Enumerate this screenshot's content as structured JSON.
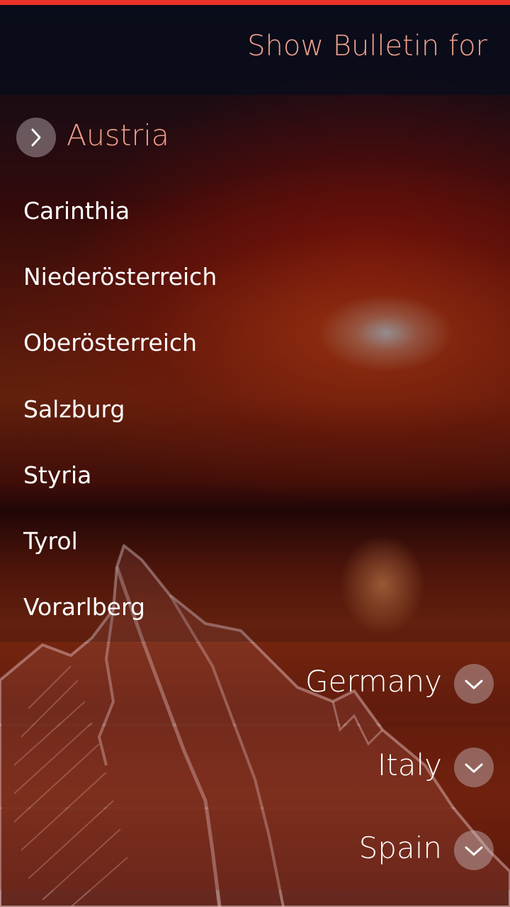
{
  "header": {
    "title": "Show Bulletin for"
  },
  "accent_color": "#e8322a",
  "highlight_color": "#f0a08c",
  "expanded_country": {
    "name": "Austria",
    "icon": "chevron-right-icon",
    "regions": [
      "Carinthia",
      "Niederösterreich",
      "Oberösterreich",
      "Salzburg",
      "Styria",
      "Tyrol",
      "Vorarlberg"
    ]
  },
  "collapsed_countries": [
    {
      "name": "Germany",
      "icon": "chevron-down-icon"
    },
    {
      "name": "Italy",
      "icon": "chevron-down-icon"
    },
    {
      "name": "Spain",
      "icon": "chevron-down-icon"
    }
  ]
}
